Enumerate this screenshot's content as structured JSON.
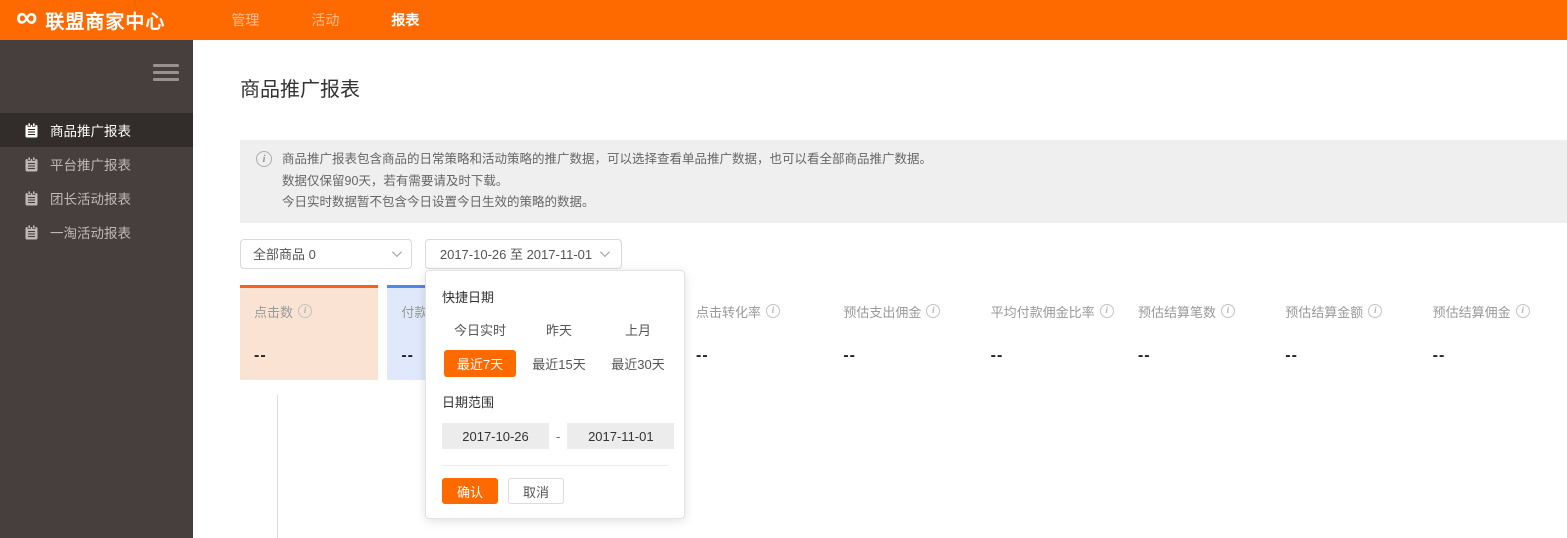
{
  "header": {
    "brand": "联盟商家中心",
    "nav": [
      {
        "label": "管理",
        "active": false
      },
      {
        "label": "活动",
        "active": false
      },
      {
        "label": "报表",
        "active": true
      }
    ]
  },
  "sidebar": {
    "items": [
      {
        "label": "商品推广报表",
        "active": true
      },
      {
        "label": "平台推广报表",
        "active": false
      },
      {
        "label": "团长活动报表",
        "active": false
      },
      {
        "label": "一淘活动报表",
        "active": false
      }
    ]
  },
  "page": {
    "title": "商品推广报表",
    "notice_lines": [
      "商品推广报表包含商品的日常策略和活动策略的推广数据，可以选择查看单品推广数据，也可以看全部商品推广数据。",
      "数据仅保留90天，若有需要请及时下载。",
      "今日实时数据暂不包含今日设置今日生效的策略的数据。"
    ]
  },
  "filters": {
    "product_select_value": "全部商品 0",
    "date_select_value": "2017-10-26 至 2017-11-01"
  },
  "metrics": [
    {
      "label": "点击数",
      "value": "--",
      "state": "selected-orange"
    },
    {
      "label": "付款",
      "value": "--",
      "state": "selected-blue"
    },
    {
      "label": "",
      "value": "",
      "state": "covered-by-popup"
    },
    {
      "label": "点击转化率",
      "value": "--",
      "state": "normal"
    },
    {
      "label": "预估支出佣金",
      "value": "--",
      "state": "normal"
    },
    {
      "label": "平均付款佣金比率",
      "value": "--",
      "state": "normal"
    },
    {
      "label": "预估结算笔数",
      "value": "--",
      "state": "normal"
    },
    {
      "label": "预估结算金额",
      "value": "--",
      "state": "normal"
    },
    {
      "label": "预估结算佣金",
      "value": "--",
      "state": "normal"
    }
  ],
  "date_popup": {
    "quick_title": "快捷日期",
    "quick_options": [
      {
        "label": "今日实时",
        "selected": false
      },
      {
        "label": "昨天",
        "selected": false
      },
      {
        "label": "上月",
        "selected": false
      },
      {
        "label": "最近7天",
        "selected": true
      },
      {
        "label": "最近15天",
        "selected": false
      },
      {
        "label": "最近30天",
        "selected": false
      }
    ],
    "range_title": "日期范围",
    "start_date": "2017-10-26",
    "separator": "-",
    "end_date": "2017-11-01",
    "confirm_label": "确认",
    "cancel_label": "取消"
  },
  "colors": {
    "brand_orange": "#FF6A00",
    "sidebar_bg": "#463F3D",
    "sidebar_active_bg": "#322D2B",
    "card_orange_border": "#F4621B",
    "card_orange_bg": "#FBE3D3",
    "card_blue_border": "#5186EC",
    "card_blue_bg": "#DFE9FB",
    "notice_bg": "#EFEFEF"
  }
}
